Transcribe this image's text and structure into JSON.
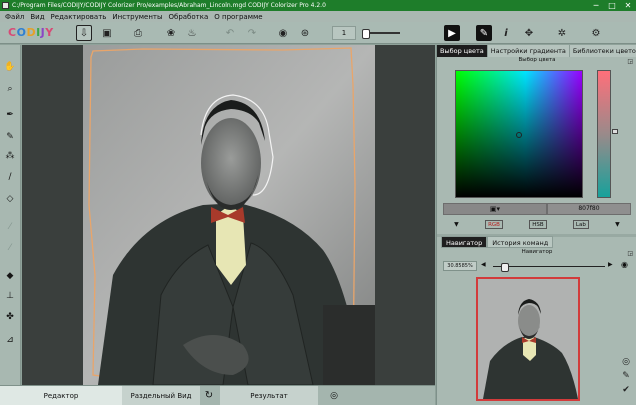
{
  "window": {
    "title": "C:/Program Files/CODIJY/CODIJY Colorizer Pro/examples/Abraham_Lincoln.mgd CODIJY Colorizer Pro 4.2.0",
    "minimize_glyph": "─",
    "maximize_glyph": "□",
    "close_glyph": "✕"
  },
  "menu": [
    "Файл",
    "Вид",
    "Редактировать",
    "Инструменты",
    "Обработка",
    "О программе"
  ],
  "logo": {
    "letters": [
      "C",
      "O",
      "D",
      "I",
      "J",
      "Y"
    ]
  },
  "toolbar": {
    "zoom_value": "1",
    "icons": [
      "open-icon",
      "save-icon",
      "print-icon",
      "recolor-icon",
      "color-mix-icon",
      "undo-icon",
      "redo-icon",
      "eye-icon",
      "preview-icon",
      "zoom-slider",
      "play-icon",
      "pen-icon",
      "info-icon",
      "fullscreen-icon",
      "puzzle-icon",
      "gear-icon"
    ]
  },
  "left_tools": [
    "hand-icon",
    "magnifier-icon",
    "brush-icon",
    "pencil-icon",
    "spray-icon",
    "stroke-icon",
    "eraser-icon",
    "line-icon",
    "fill-icon",
    "stamp-icon",
    "mixer-icon",
    "eyedropper-icon"
  ],
  "bottom_tabs": {
    "editor": "Редактор",
    "split_view": "Раздельный Вид",
    "result": "Результат"
  },
  "right_panel": {
    "tabs": [
      "Выбор цвета",
      "Настройки градиента",
      "Библиотеки цветов"
    ],
    "color_picker_title": "Выбор цвета",
    "dock_glyph": "◲",
    "hex_value": "807f80",
    "mode_labels": [
      "RGB",
      "HSB",
      "Lab"
    ],
    "current_color": "#808080",
    "nav_tabs": [
      "Навигатор",
      "История команд"
    ],
    "navigator_title": "Навигатор",
    "nav_zoom": "30.8585%"
  },
  "colors": {
    "titlebar": "#1e7d2a",
    "app_background": "#8fa29a",
    "canvas_background": "#3a3f3d",
    "navigator_frame": "#d23b3b"
  }
}
